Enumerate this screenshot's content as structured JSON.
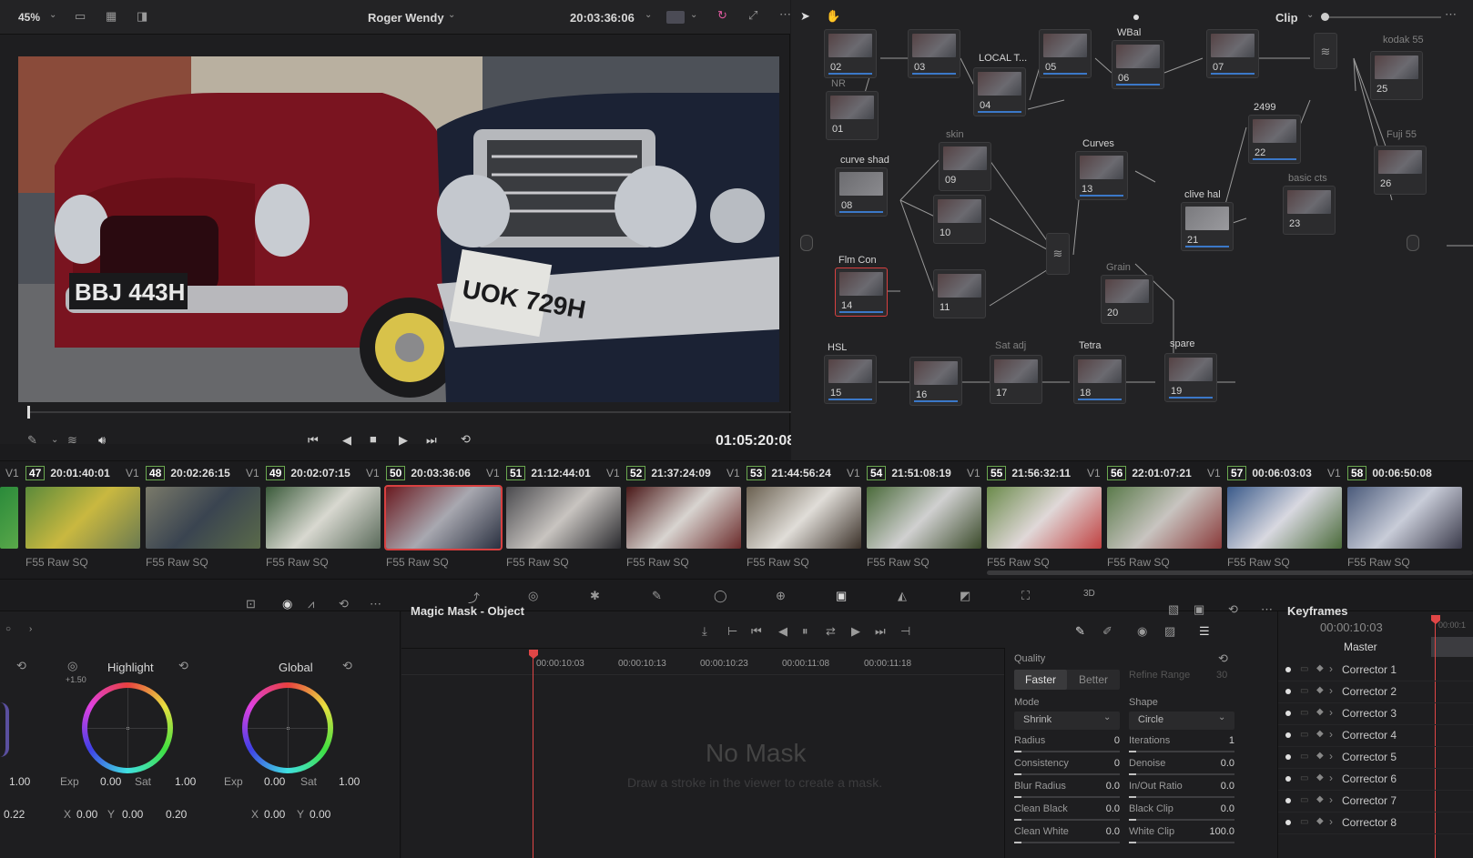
{
  "viewer": {
    "zoom": "45%",
    "clip_name": "Roger Wendy",
    "timecode_top": "20:03:36:06",
    "timecode": "01:05:20:08",
    "plate1": "BBJ 443H",
    "plate2": "UOK 729H"
  },
  "nodes": {
    "mode": "Clip",
    "list": [
      {
        "n": "02",
        "label": ""
      },
      {
        "n": "03",
        "label": ""
      },
      {
        "n": "04",
        "label": "LOCAL T..."
      },
      {
        "n": "05",
        "label": ""
      },
      {
        "n": "06",
        "label": "WBal"
      },
      {
        "n": "07",
        "label": ""
      },
      {
        "n": "01",
        "label": "NR"
      },
      {
        "n": "09",
        "label": "skin"
      },
      {
        "n": "08",
        "label": "curve shad"
      },
      {
        "n": "13",
        "label": "Curves"
      },
      {
        "n": "22",
        "label": "2499"
      },
      {
        "n": "25",
        "label": "kodak 55"
      },
      {
        "n": "26",
        "label": "Fuji 55"
      },
      {
        "n": "23",
        "label": "basic cts"
      },
      {
        "n": "21",
        "label": "clive hal"
      },
      {
        "n": "10",
        "label": ""
      },
      {
        "n": "14",
        "label": "Flm Con"
      },
      {
        "n": "11",
        "label": ""
      },
      {
        "n": "20",
        "label": "Grain"
      },
      {
        "n": "15",
        "label": "HSL"
      },
      {
        "n": "16",
        "label": ""
      },
      {
        "n": "17",
        "label": "Sat adj"
      },
      {
        "n": "18",
        "label": "Tetra"
      },
      {
        "n": "19",
        "label": "spare"
      }
    ]
  },
  "timeline": {
    "clips": [
      {
        "track": "V1",
        "num": "47",
        "tc": "20:01:40:01",
        "codec": "F55 Raw SQ"
      },
      {
        "track": "V1",
        "num": "48",
        "tc": "20:02:26:15",
        "codec": "F55 Raw SQ"
      },
      {
        "track": "V1",
        "num": "49",
        "tc": "20:02:07:15",
        "codec": "F55 Raw SQ"
      },
      {
        "track": "V1",
        "num": "50",
        "tc": "20:03:36:06",
        "codec": "F55 Raw SQ"
      },
      {
        "track": "V1",
        "num": "51",
        "tc": "21:12:44:01",
        "codec": "F55 Raw SQ"
      },
      {
        "track": "V1",
        "num": "52",
        "tc": "21:37:24:09",
        "codec": "F55 Raw SQ"
      },
      {
        "track": "V1",
        "num": "53",
        "tc": "21:44:56:24",
        "codec": "F55 Raw SQ"
      },
      {
        "track": "V1",
        "num": "54",
        "tc": "21:51:08:19",
        "codec": "F55 Raw SQ"
      },
      {
        "track": "V1",
        "num": "55",
        "tc": "21:56:32:11",
        "codec": "F55 Raw SQ"
      },
      {
        "track": "V1",
        "num": "56",
        "tc": "22:01:07:21",
        "codec": "F55 Raw SQ"
      },
      {
        "track": "V1",
        "num": "57",
        "tc": "00:06:03:03",
        "codec": "F55 Raw SQ"
      },
      {
        "track": "V1",
        "num": "58",
        "tc": "00:06:50:08",
        "codec": "F55 Raw SQ"
      }
    ]
  },
  "wheels": {
    "highlight": {
      "title": "Highlight",
      "offset": "+1.50",
      "exp": "0.00",
      "sat": "1.00",
      "x": "0.00",
      "y": "0.00",
      "z": "0.20"
    },
    "global": {
      "title": "Global",
      "exp": "0.00",
      "sat": "1.00",
      "x": "0.00",
      "y": "0.00"
    },
    "left_val": "1.00",
    "left_val2": "0.22",
    "exp_label": "Exp",
    "sat_label": "Sat",
    "x_label": "X",
    "y_label": "Y"
  },
  "mask": {
    "title": "Magic Mask - Object",
    "ruler": [
      "00:00:10:03",
      "00:00:10:13",
      "00:00:10:23",
      "00:00:11:08",
      "00:00:11:18"
    ],
    "empty_title": "No Mask",
    "empty_hint": "Draw a stroke in the viewer to create a mask.",
    "quality_label": "Quality",
    "faster": "Faster",
    "better": "Better",
    "refine_label": "Refine Range",
    "refine_val": "30",
    "mode_label": "Mode",
    "mode_val": "Shrink",
    "shape_label": "Shape",
    "shape_val": "Circle",
    "params_left": [
      {
        "k": "Radius",
        "v": "0"
      },
      {
        "k": "Consistency",
        "v": "0"
      },
      {
        "k": "Blur Radius",
        "v": "0.0"
      },
      {
        "k": "Clean Black",
        "v": "0.0"
      },
      {
        "k": "Clean White",
        "v": "0.0"
      }
    ],
    "params_right": [
      {
        "k": "Iterations",
        "v": "1"
      },
      {
        "k": "Denoise",
        "v": "0.0"
      },
      {
        "k": "In/Out Ratio",
        "v": "0.0"
      },
      {
        "k": "Black Clip",
        "v": "0.0"
      },
      {
        "k": "White Clip",
        "v": "100.0"
      }
    ]
  },
  "keyframes": {
    "title": "Keyframes",
    "tc": "00:00:10:03",
    "tc_right": "00:00:1",
    "master": "Master",
    "rows": [
      "Corrector 1",
      "Corrector 2",
      "Corrector 3",
      "Corrector 4",
      "Corrector 5",
      "Corrector 6",
      "Corrector 7",
      "Corrector 8"
    ]
  },
  "colors": {
    "accent_green": "#7ec23c",
    "accent_blue": "#2a98e0",
    "playhead_red": "#e04646",
    "selected_red": "#d84040"
  }
}
